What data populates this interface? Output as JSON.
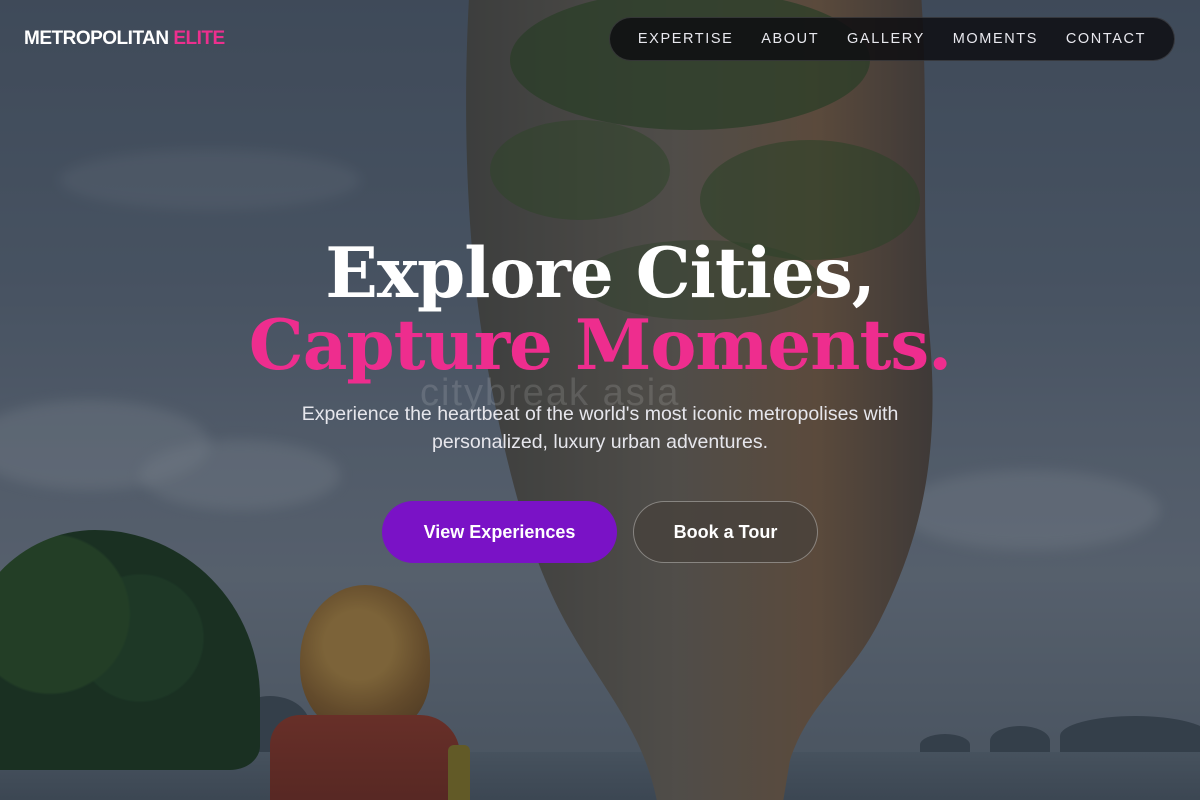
{
  "brand": {
    "name": "METROPOLITAN",
    "accent": "ELITE",
    "accent_color": "#ec2f8e"
  },
  "nav": {
    "items": [
      {
        "label": "EXPERTISE"
      },
      {
        "label": "ABOUT"
      },
      {
        "label": "GALLERY"
      },
      {
        "label": "MOMENTS"
      },
      {
        "label": "CONTACT"
      }
    ]
  },
  "hero": {
    "title_line1": "Explore Cities,",
    "title_line2": "Capture Moments.",
    "subtitle": "Experience the heartbeat of the world's most iconic metropolises with personalized, luxury urban adventures.",
    "primary_cta": "View Experiences",
    "secondary_cta": "Book a Tour",
    "watermark": "citybreak asia"
  },
  "colors": {
    "primary_button": "#7a12c6",
    "title_accent": "#ee2d8e"
  }
}
